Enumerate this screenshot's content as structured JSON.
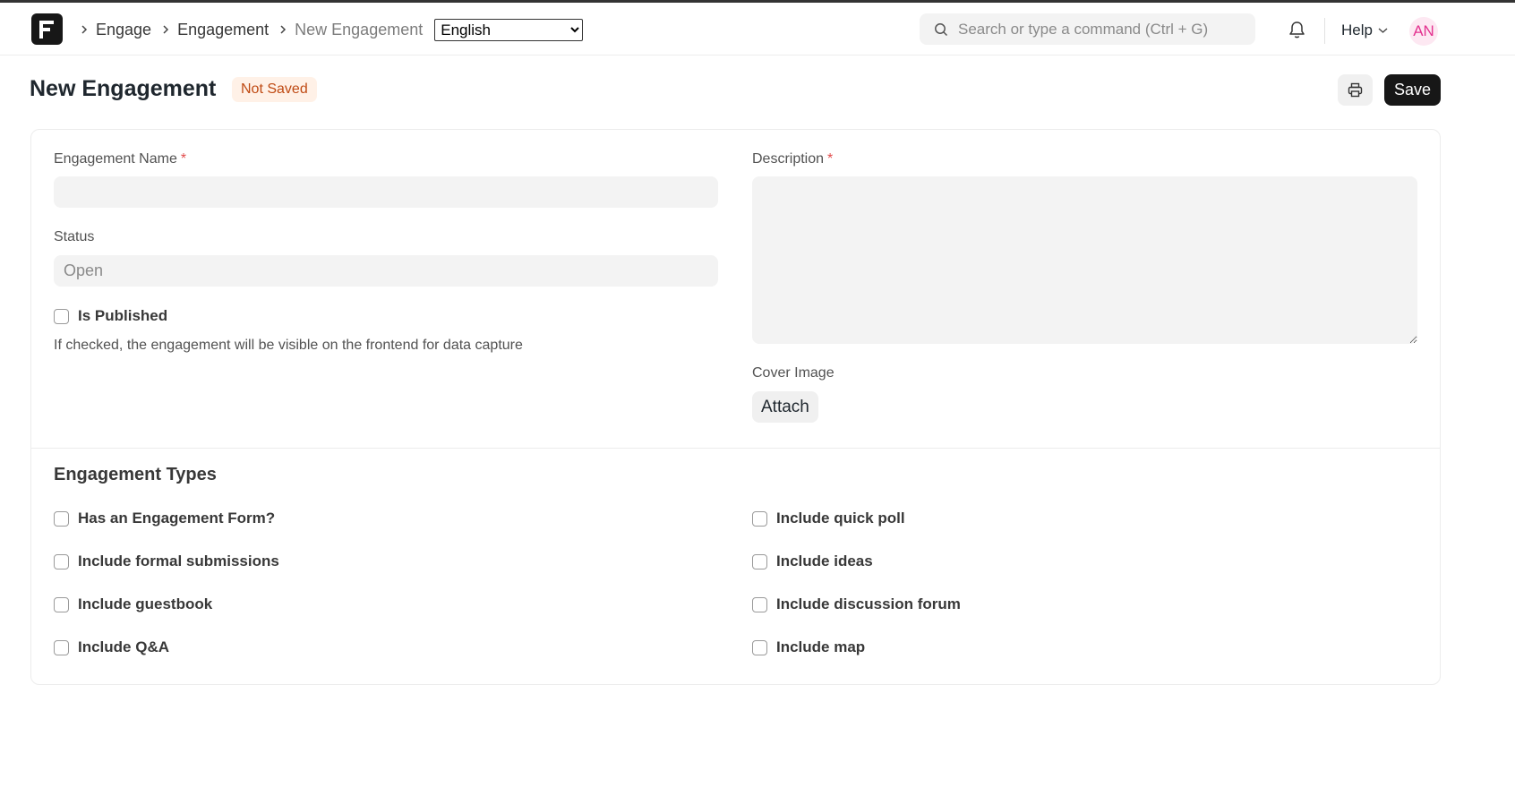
{
  "navbar": {
    "breadcrumbs": [
      "Engage",
      "Engagement",
      "New Engagement"
    ],
    "language": {
      "selected": "English",
      "options": [
        "English"
      ]
    },
    "search_placeholder": "Search or type a command (Ctrl + G)",
    "help_label": "Help",
    "avatar_initials": "AN"
  },
  "page": {
    "title": "New Engagement",
    "indicator": "Not Saved",
    "save_label": "Save"
  },
  "form": {
    "engagement_name": {
      "label": "Engagement Name",
      "value": "",
      "required": true
    },
    "status": {
      "label": "Status",
      "placeholder": "Open"
    },
    "is_published": {
      "label": "Is Published",
      "checked": false,
      "description": "If checked, the engagement will be visible on the frontend for data capture"
    },
    "description": {
      "label": "Description",
      "value": "",
      "required": true
    },
    "cover_image": {
      "label": "Cover Image",
      "button": "Attach"
    },
    "engagement_types": {
      "title": "Engagement Types",
      "left": [
        "Has an Engagement Form?",
        "Include formal submissions",
        "Include guestbook",
        "Include Q&A"
      ],
      "right": [
        "Include quick poll",
        "Include ideas",
        "Include discussion forum",
        "Include map"
      ]
    }
  },
  "colors": {
    "brand_dark": "#171717",
    "indicator_bg": "#fff1e7",
    "indicator_text": "#bf4a13",
    "avatar_text": "#e3318f",
    "required": "#e24c4c"
  }
}
